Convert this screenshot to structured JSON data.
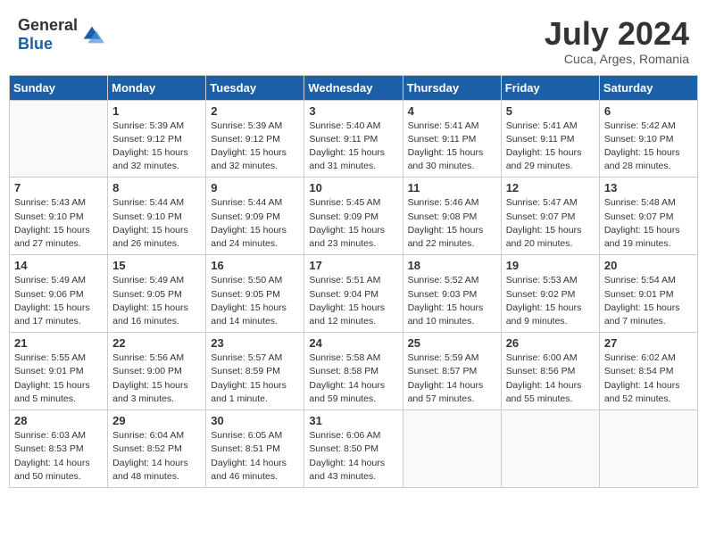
{
  "header": {
    "logo_general": "General",
    "logo_blue": "Blue",
    "month_year": "July 2024",
    "location": "Cuca, Arges, Romania"
  },
  "weekdays": [
    "Sunday",
    "Monday",
    "Tuesday",
    "Wednesday",
    "Thursday",
    "Friday",
    "Saturday"
  ],
  "weeks": [
    [
      {
        "day": "",
        "sunrise": "",
        "sunset": "",
        "daylight": ""
      },
      {
        "day": "1",
        "sunrise": "5:39 AM",
        "sunset": "9:12 PM",
        "daylight": "15 hours and 32 minutes."
      },
      {
        "day": "2",
        "sunrise": "5:39 AM",
        "sunset": "9:12 PM",
        "daylight": "15 hours and 32 minutes."
      },
      {
        "day": "3",
        "sunrise": "5:40 AM",
        "sunset": "9:11 PM",
        "daylight": "15 hours and 31 minutes."
      },
      {
        "day": "4",
        "sunrise": "5:41 AM",
        "sunset": "9:11 PM",
        "daylight": "15 hours and 30 minutes."
      },
      {
        "day": "5",
        "sunrise": "5:41 AM",
        "sunset": "9:11 PM",
        "daylight": "15 hours and 29 minutes."
      },
      {
        "day": "6",
        "sunrise": "5:42 AM",
        "sunset": "9:10 PM",
        "daylight": "15 hours and 28 minutes."
      }
    ],
    [
      {
        "day": "7",
        "sunrise": "5:43 AM",
        "sunset": "9:10 PM",
        "daylight": "15 hours and 27 minutes."
      },
      {
        "day": "8",
        "sunrise": "5:44 AM",
        "sunset": "9:10 PM",
        "daylight": "15 hours and 26 minutes."
      },
      {
        "day": "9",
        "sunrise": "5:44 AM",
        "sunset": "9:09 PM",
        "daylight": "15 hours and 24 minutes."
      },
      {
        "day": "10",
        "sunrise": "5:45 AM",
        "sunset": "9:09 PM",
        "daylight": "15 hours and 23 minutes."
      },
      {
        "day": "11",
        "sunrise": "5:46 AM",
        "sunset": "9:08 PM",
        "daylight": "15 hours and 22 minutes."
      },
      {
        "day": "12",
        "sunrise": "5:47 AM",
        "sunset": "9:07 PM",
        "daylight": "15 hours and 20 minutes."
      },
      {
        "day": "13",
        "sunrise": "5:48 AM",
        "sunset": "9:07 PM",
        "daylight": "15 hours and 19 minutes."
      }
    ],
    [
      {
        "day": "14",
        "sunrise": "5:49 AM",
        "sunset": "9:06 PM",
        "daylight": "15 hours and 17 minutes."
      },
      {
        "day": "15",
        "sunrise": "5:49 AM",
        "sunset": "9:05 PM",
        "daylight": "15 hours and 16 minutes."
      },
      {
        "day": "16",
        "sunrise": "5:50 AM",
        "sunset": "9:05 PM",
        "daylight": "15 hours and 14 minutes."
      },
      {
        "day": "17",
        "sunrise": "5:51 AM",
        "sunset": "9:04 PM",
        "daylight": "15 hours and 12 minutes."
      },
      {
        "day": "18",
        "sunrise": "5:52 AM",
        "sunset": "9:03 PM",
        "daylight": "15 hours and 10 minutes."
      },
      {
        "day": "19",
        "sunrise": "5:53 AM",
        "sunset": "9:02 PM",
        "daylight": "15 hours and 9 minutes."
      },
      {
        "day": "20",
        "sunrise": "5:54 AM",
        "sunset": "9:01 PM",
        "daylight": "15 hours and 7 minutes."
      }
    ],
    [
      {
        "day": "21",
        "sunrise": "5:55 AM",
        "sunset": "9:01 PM",
        "daylight": "15 hours and 5 minutes."
      },
      {
        "day": "22",
        "sunrise": "5:56 AM",
        "sunset": "9:00 PM",
        "daylight": "15 hours and 3 minutes."
      },
      {
        "day": "23",
        "sunrise": "5:57 AM",
        "sunset": "8:59 PM",
        "daylight": "15 hours and 1 minute."
      },
      {
        "day": "24",
        "sunrise": "5:58 AM",
        "sunset": "8:58 PM",
        "daylight": "14 hours and 59 minutes."
      },
      {
        "day": "25",
        "sunrise": "5:59 AM",
        "sunset": "8:57 PM",
        "daylight": "14 hours and 57 minutes."
      },
      {
        "day": "26",
        "sunrise": "6:00 AM",
        "sunset": "8:56 PM",
        "daylight": "14 hours and 55 minutes."
      },
      {
        "day": "27",
        "sunrise": "6:02 AM",
        "sunset": "8:54 PM",
        "daylight": "14 hours and 52 minutes."
      }
    ],
    [
      {
        "day": "28",
        "sunrise": "6:03 AM",
        "sunset": "8:53 PM",
        "daylight": "14 hours and 50 minutes."
      },
      {
        "day": "29",
        "sunrise": "6:04 AM",
        "sunset": "8:52 PM",
        "daylight": "14 hours and 48 minutes."
      },
      {
        "day": "30",
        "sunrise": "6:05 AM",
        "sunset": "8:51 PM",
        "daylight": "14 hours and 46 minutes."
      },
      {
        "day": "31",
        "sunrise": "6:06 AM",
        "sunset": "8:50 PM",
        "daylight": "14 hours and 43 minutes."
      },
      {
        "day": "",
        "sunrise": "",
        "sunset": "",
        "daylight": ""
      },
      {
        "day": "",
        "sunrise": "",
        "sunset": "",
        "daylight": ""
      },
      {
        "day": "",
        "sunrise": "",
        "sunset": "",
        "daylight": ""
      }
    ]
  ]
}
